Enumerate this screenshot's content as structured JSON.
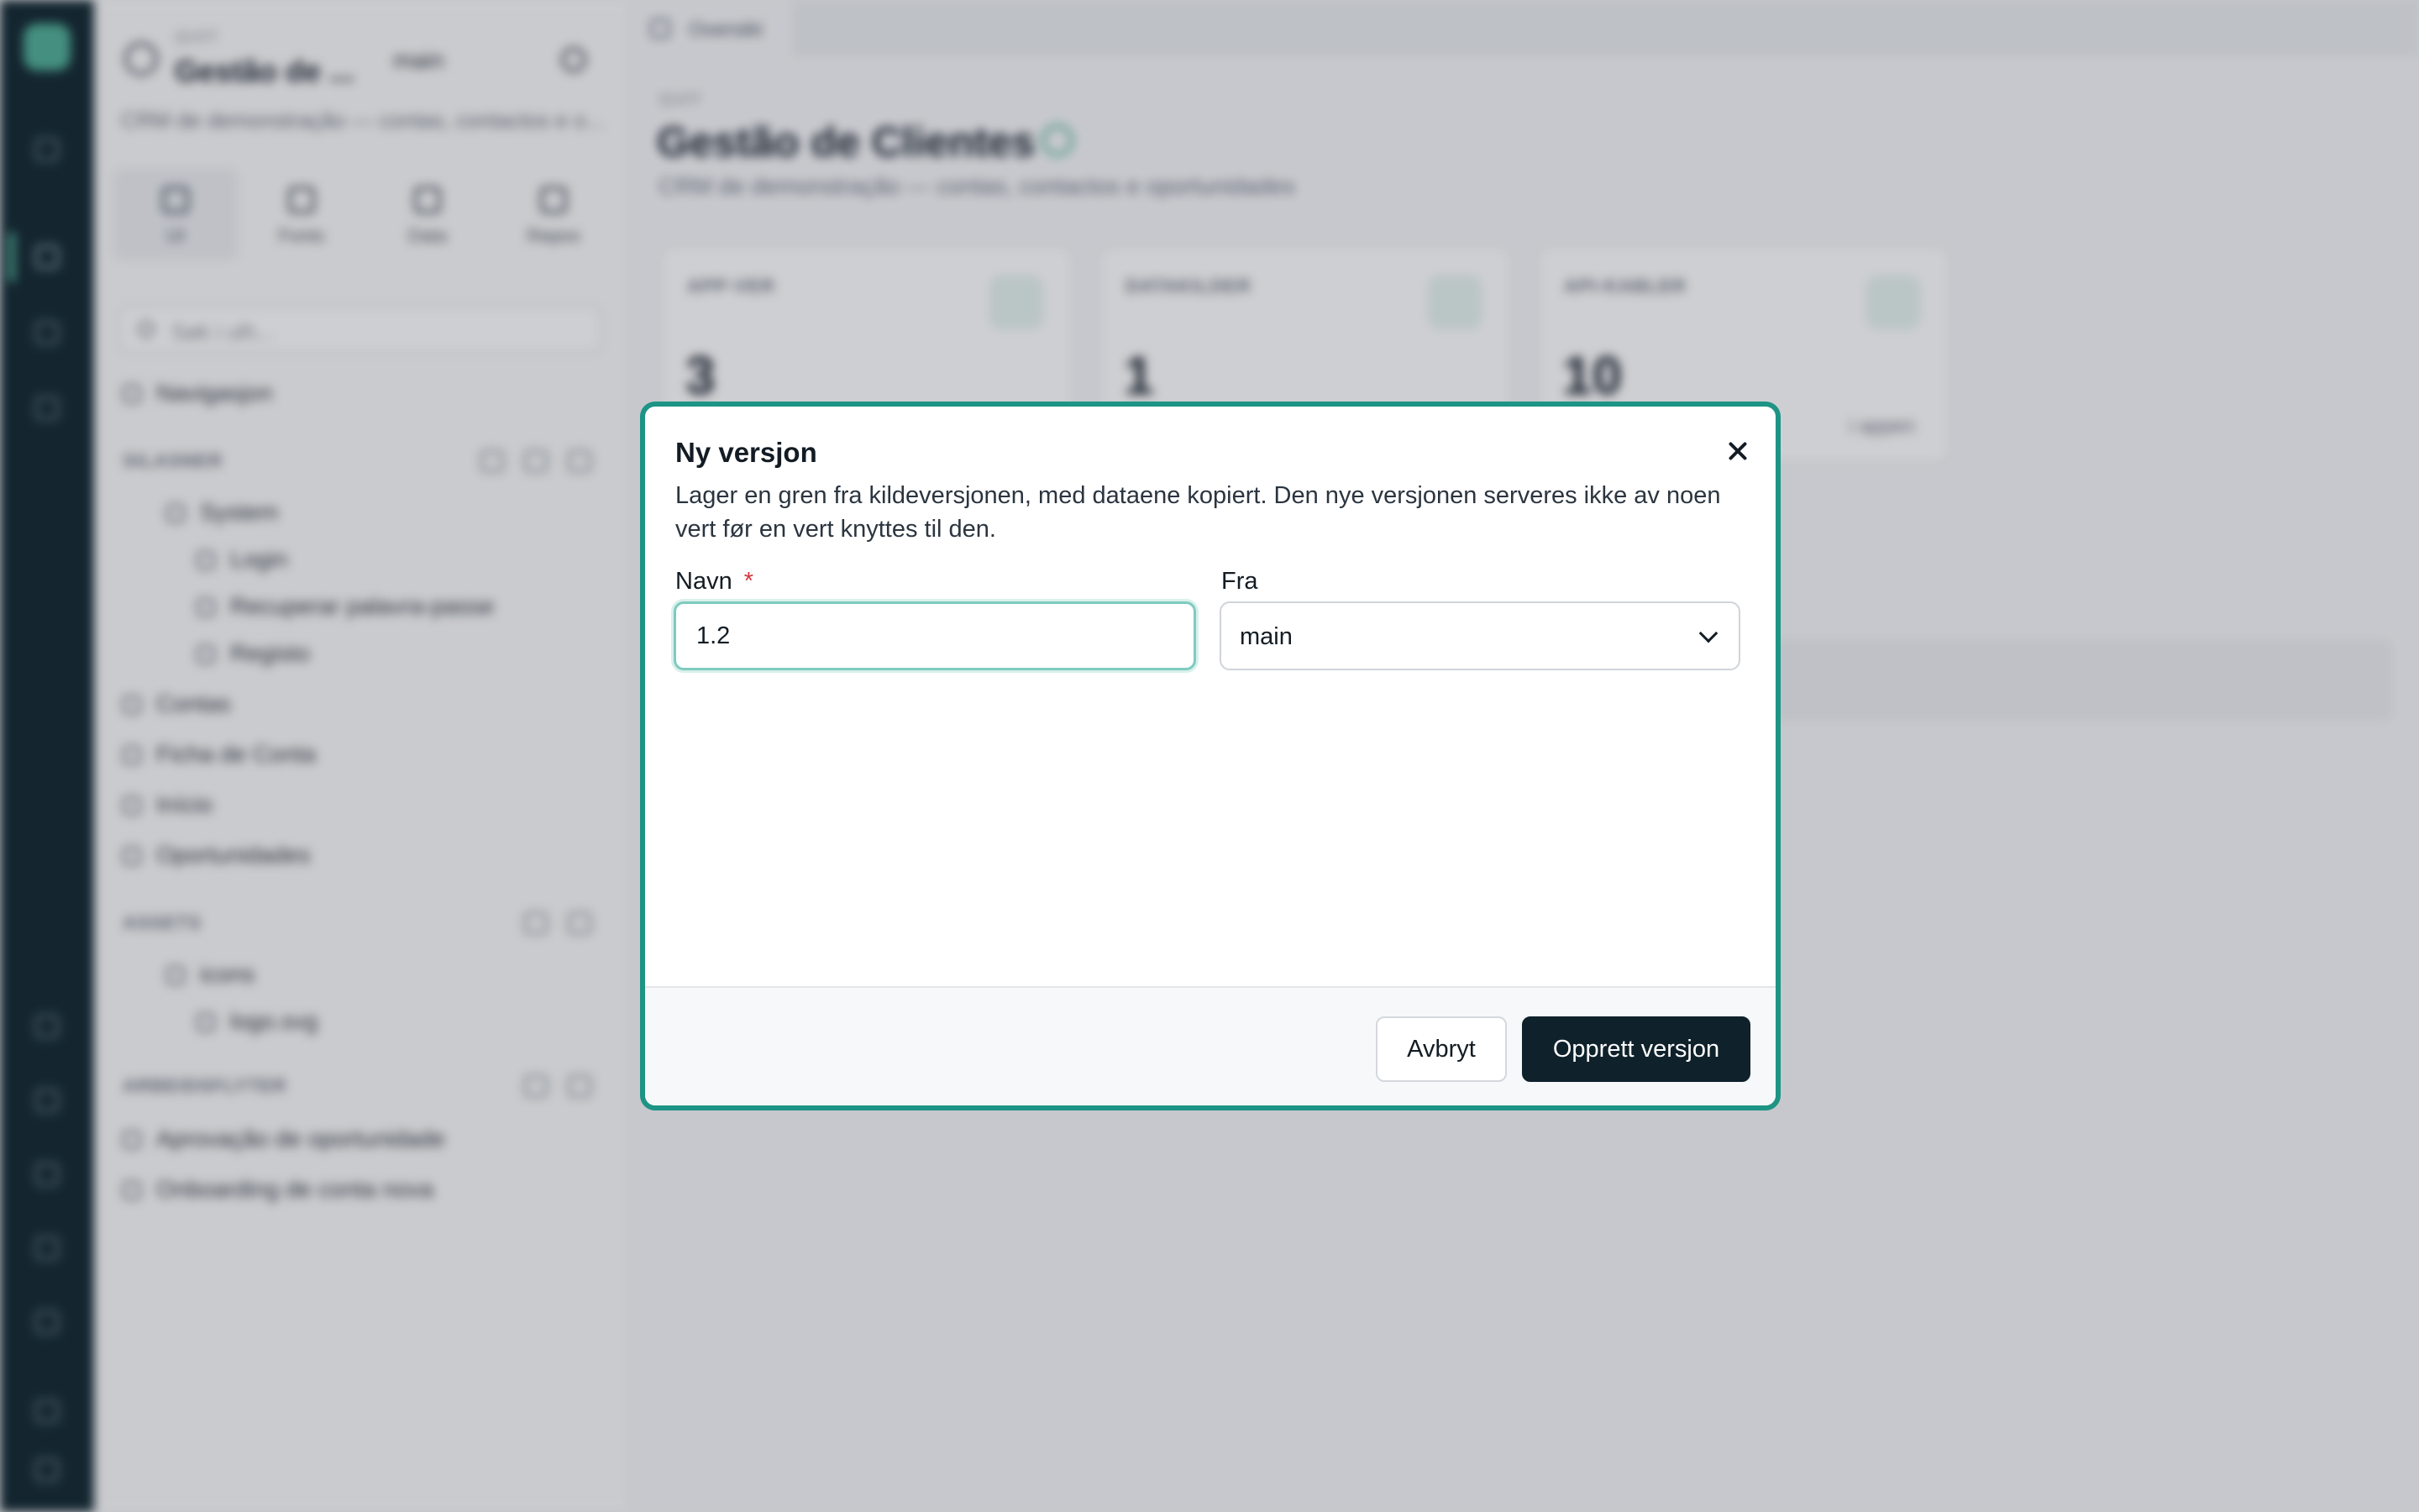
{
  "background": {
    "project": {
      "kicker": "QUOT",
      "title_short": "Gestão de ...",
      "branch": "main",
      "description": "CRM de demonstração — contas, contactos e o..."
    },
    "modes": [
      "UI",
      "Fonts",
      "Data",
      "Repos"
    ],
    "search_placeholder": "Søk i ulh...",
    "navigation_label": "Navigasjon",
    "sections": {
      "pages": "SILASNER",
      "assets": "ASSETS",
      "workflows": "ARBEIDSFLYTER"
    },
    "pages": [
      "System",
      "Login",
      "Recuperar palavra-passe",
      "Registo",
      "Contas",
      "Ficha de Conta",
      "Início",
      "Oportunidades"
    ],
    "assets": [
      "icons",
      "logo.svg"
    ],
    "workflows": [
      "Aprovação de oportunidade",
      "Onboarding de conta nova"
    ],
    "tab": "Oversikt",
    "main_kicker": "QUOT",
    "main_title": "Gestão de Clientes",
    "main_subtitle": "CRM de demonstração — contas, contactos e oportunidades",
    "cards": [
      {
        "label": "APP-VER",
        "value": "3",
        "note": ""
      },
      {
        "label": "DATAKILDER",
        "value": "1",
        "note": ""
      },
      {
        "label": "API-KABLER",
        "value": "10",
        "note": "i appen"
      }
    ]
  },
  "dialog": {
    "title": "Ny versjon",
    "description": "Lager en gren fra kildeversjonen, med dataene kopiert. Den nye versjonen serveres ikke av noen vert før en vert knyttes til den.",
    "name_label": "Navn",
    "required_mark": "*",
    "name_value": "1.2",
    "from_label": "Fra",
    "from_value": "main",
    "cancel_label": "Avbryt",
    "create_label": "Opprett versjon"
  },
  "colors": {
    "accent": "#1d9485",
    "primary_button": "#0f212b",
    "required": "#d4353f",
    "rail": "#11262f"
  }
}
